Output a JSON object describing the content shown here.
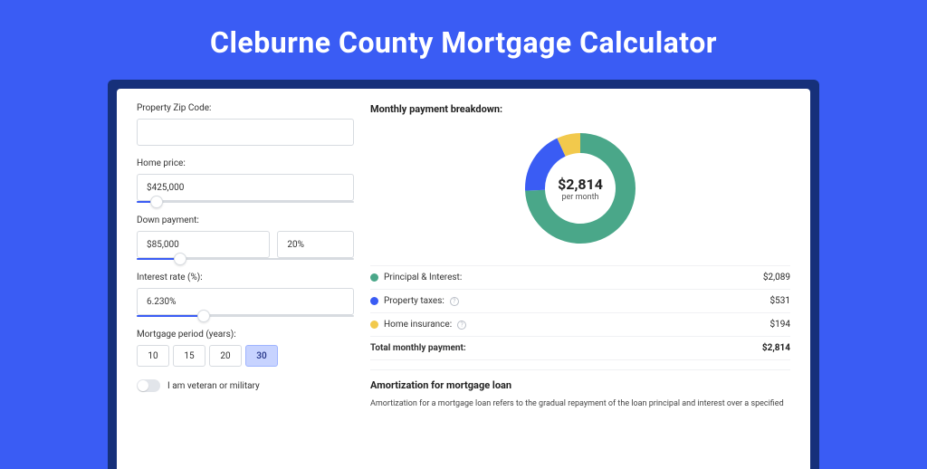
{
  "title": "Cleburne County Mortgage Calculator",
  "form": {
    "zip": {
      "label": "Property Zip Code:",
      "value": ""
    },
    "price": {
      "label": "Home price:",
      "value": "$425,000",
      "slider_pct": 9
    },
    "down": {
      "label": "Down payment:",
      "value": "$85,000",
      "pct": "20%",
      "slider_pct": 20
    },
    "rate": {
      "label": "Interest rate (%):",
      "value": "6.230%",
      "slider_pct": 31
    },
    "period": {
      "label": "Mortgage period (years):",
      "options": [
        "10",
        "15",
        "20",
        "30"
      ],
      "active": "30"
    },
    "veteran": {
      "label": "I am veteran or military",
      "on": false
    }
  },
  "breakdown": {
    "title": "Monthly payment breakdown:",
    "center_value": "$2,814",
    "center_sub": "per month",
    "items": [
      {
        "key": "pi",
        "label": "Principal & Interest:",
        "value": "$2,089",
        "info": false
      },
      {
        "key": "tax",
        "label": "Property taxes:",
        "value": "$531",
        "info": true
      },
      {
        "key": "ins",
        "label": "Home insurance:",
        "value": "$194",
        "info": true
      }
    ],
    "total_label": "Total monthly payment:",
    "total_value": "$2,814"
  },
  "amort": {
    "title": "Amortization for mortgage loan",
    "body": "Amortization for a mortgage loan refers to the gradual repayment of the loan principal and interest over a specified"
  },
  "chart_data": {
    "type": "pie",
    "title": "Monthly payment breakdown",
    "categories": [
      "Principal & Interest",
      "Property taxes",
      "Home insurance"
    ],
    "values": [
      2089,
      531,
      194
    ],
    "colors": [
      "#4aa789",
      "#3a5cf4",
      "#f2c94c"
    ],
    "center_label": "$2,814 per month"
  }
}
